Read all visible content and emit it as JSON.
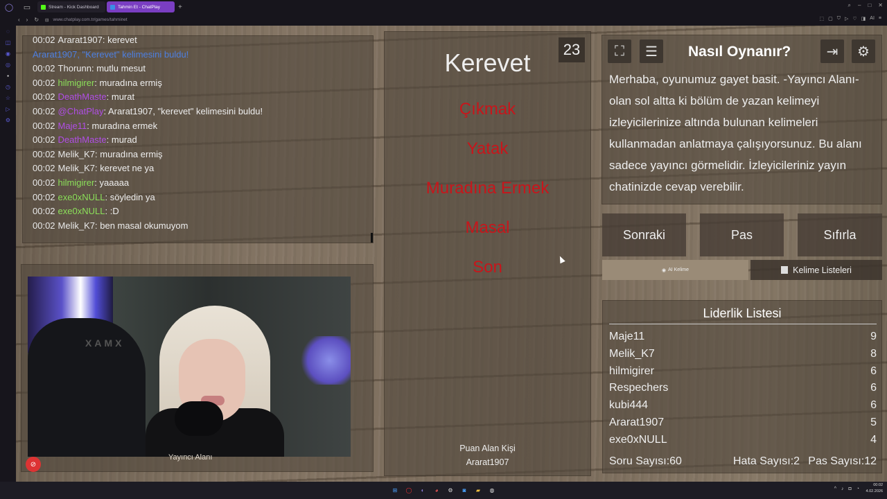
{
  "browser": {
    "tabs": [
      {
        "label": "Stream - Kick Dashboard",
        "active": false,
        "favicon_color": "#53fc18"
      },
      {
        "label": "Tahmin Et - ChatPlay",
        "active": true,
        "favicon_color": "#3a8ee6"
      }
    ],
    "url": "www.chatplay.com.tr/games/tahminet"
  },
  "chat": {
    "messages": [
      {
        "time": "00:02",
        "user": "Ararat1907",
        "text": ": kerevet",
        "user_color": "#e8e8e8",
        "partial": true
      },
      {
        "time": "",
        "user": "Ararat1907, \"Kerevet\" kelimesini buldu!",
        "text": "",
        "user_color": "#4d7fe0"
      },
      {
        "time": "00:02",
        "user": "Thorunn",
        "text": ": mutlu mesut",
        "user_color": "#e8e8e8"
      },
      {
        "time": "00:02",
        "user": "hilmigirer",
        "text": ": muradına ermiş",
        "user_color": "#8ce05a"
      },
      {
        "time": "00:02",
        "user": "DeathMaste",
        "text": ": murat",
        "user_color": "#b04ee6"
      },
      {
        "time": "00:02",
        "user": "@ChatPlay",
        "text": ": Ararat1907, \"kerevet\" kelimesini buldu!",
        "user_color": "#b04ee6"
      },
      {
        "time": "00:02",
        "user": "Maje11",
        "text": ": muradına ermek",
        "user_color": "#b04ee6"
      },
      {
        "time": "00:02",
        "user": "DeathMaste",
        "text": ": murad",
        "user_color": "#b04ee6"
      },
      {
        "time": "00:02",
        "user": "Melik_K7",
        "text": ": muradına ermiş",
        "user_color": "#e8e8e8"
      },
      {
        "time": "00:02",
        "user": "Melik_K7",
        "text": ": kerevet ne ya",
        "user_color": "#e8e8e8"
      },
      {
        "time": "00:02",
        "user": "hilmigirer",
        "text": ": yaaaaa",
        "user_color": "#8ce05a"
      },
      {
        "time": "00:02",
        "user": "exe0xNULL",
        "text": ": söyledin ya",
        "user_color": "#8ce05a"
      },
      {
        "time": "00:02",
        "user": "exe0xNULL",
        "text": ": :D",
        "user_color": "#8ce05a"
      },
      {
        "time": "00:02",
        "user": "Melik_K7",
        "text": ": ben masal okumuyom",
        "user_color": "#e8e8e8"
      }
    ]
  },
  "camera": {
    "label": "Yayıncı Alanı",
    "chair_text": "XAMX"
  },
  "game": {
    "timer": "23",
    "word": "Kerevet",
    "forbidden": [
      "Çıkmak",
      "Yatak",
      "Muradına Ermek",
      "Masal",
      "Son"
    ],
    "scorer_label": "Puan Alan Kişi",
    "scorer_name": "Ararat1907"
  },
  "info": {
    "title": "Nasıl Oynanır?",
    "text": "Merhaba, oyunumuz gayet basit. -Yayıncı Alanı- olan sol altta ki bölüm de yazan kelimeyi izleyicilerinize altında bulunan kelimeleri kullanmadan anlatmaya çalışıyorsunuz. Bu alanı sadece yayıncı görmelidir. İzleyicileriniz yayın chatinizde cevap verebilir."
  },
  "actions": {
    "next": "Sonraki",
    "pass": "Pas",
    "reset": "Sıfırla",
    "ai_word": "AI Kelime",
    "word_lists": "Kelime Listeleri"
  },
  "leaderboard": {
    "title": "Liderlik Listesi",
    "rows": [
      {
        "name": "Maje11",
        "score": "9"
      },
      {
        "name": "Melik_K7",
        "score": "8"
      },
      {
        "name": "hilmigirer",
        "score": "6"
      },
      {
        "name": "Respechers",
        "score": "6"
      },
      {
        "name": "kubi444",
        "score": "6"
      },
      {
        "name": "Ararat1907",
        "score": "5"
      },
      {
        "name": "exe0xNULL",
        "score": "4"
      }
    ],
    "question_count": "Soru Sayısı:60",
    "error_count": "Hata Sayısı:2",
    "pass_count": "Pas Sayısı:12"
  },
  "taskbar": {
    "time": "00:02",
    "date": "4.02.2026"
  }
}
